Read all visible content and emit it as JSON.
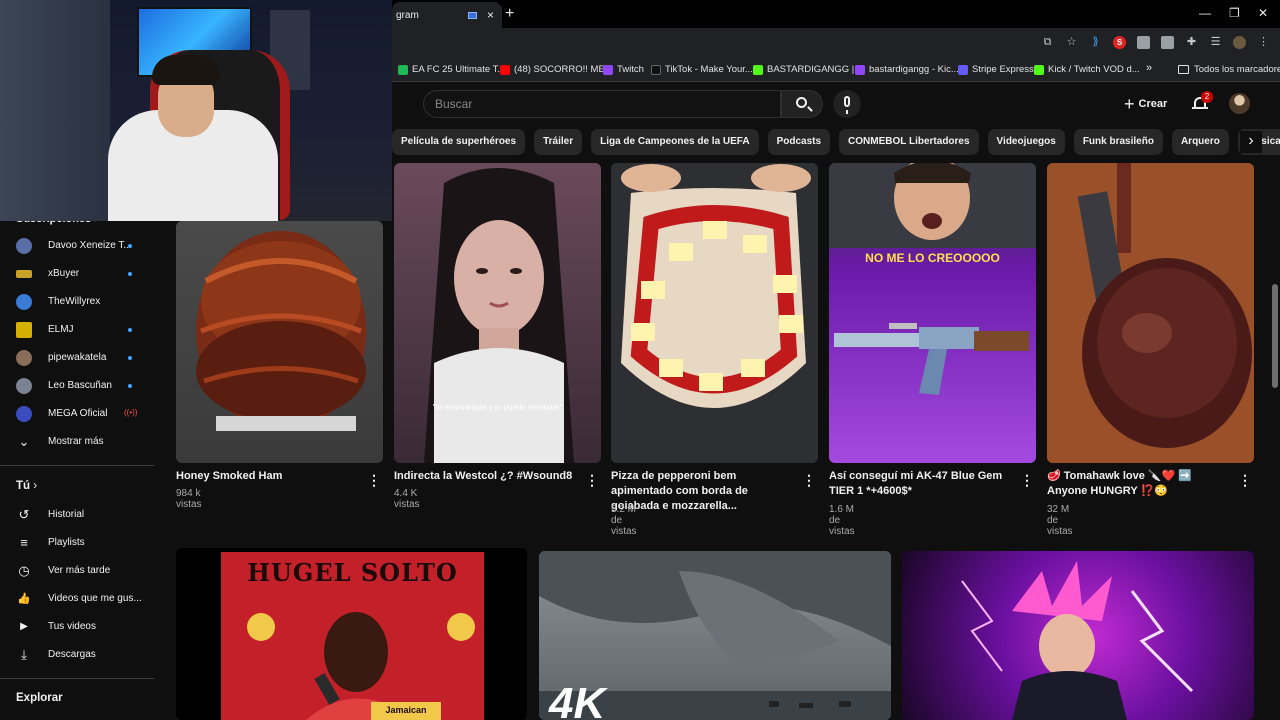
{
  "browser": {
    "tab_title": "gram",
    "new_tab": "+",
    "tab_close": "×",
    "window_minimize": "—",
    "window_restore": "❐",
    "window_close": "✕",
    "bookmarks": [
      {
        "label": "EA FC 25 Ultimate T...",
        "color": "#1db954"
      },
      {
        "label": "(48) SOCORRO!! ME...",
        "color": "#ff0000"
      },
      {
        "label": "Twitch",
        "color": "#9146ff"
      },
      {
        "label": "TikTok - Make Your...",
        "color": "#111111"
      },
      {
        "label": "BASTARDIGANGG |...",
        "color": "#53fc18"
      },
      {
        "label": "bastardigangg - Kic...",
        "color": "#9146ff"
      },
      {
        "label": "Stripe Express",
        "color": "#635bff"
      },
      {
        "label": "Kick / Twitch VOD d...",
        "color": "#53fc18"
      }
    ],
    "bookmarks_more": "»",
    "all_bookmarks": "Todos los marcadores"
  },
  "header": {
    "search_placeholder": "Buscar",
    "create_label": "Crear",
    "notification_count": "2"
  },
  "chips": [
    "Película de superhéroes",
    "Tráiler",
    "Liga de Campeones de la UEFA",
    "Podcasts",
    "CONMEBOL Libertadores",
    "Videojuegos",
    "Funk brasileño",
    "Arquero",
    "Música regional mexicana"
  ],
  "sidebar": {
    "subscriptions_title": "Suscripciones >",
    "subscriptions": [
      {
        "name": "Davoo Xeneize T...",
        "status": "new",
        "color": "#5a6fa8"
      },
      {
        "name": "xBuyer",
        "status": "new",
        "color": "#c9a227"
      },
      {
        "name": "TheWillyrex",
        "status": "none",
        "color": "#3a7bd5"
      },
      {
        "name": "ELMJ",
        "status": "new",
        "color": "#d4b000"
      },
      {
        "name": "pipewakatela",
        "status": "new",
        "color": "#8a6d5a"
      },
      {
        "name": "Leo Bascuñan",
        "status": "new",
        "color": "#7b8290"
      },
      {
        "name": "MEGA Oficial",
        "status": "live",
        "color": "#3b4cc0"
      }
    ],
    "live_glyph": "((•))",
    "show_more": "Mostrar más",
    "you_title": "Tú",
    "you_items": [
      {
        "label": "Historial",
        "icon": "history-icon",
        "glyph": "↺"
      },
      {
        "label": "Playlists",
        "icon": "playlist-icon",
        "glyph": "≡"
      },
      {
        "label": "Ver más tarde",
        "icon": "clock-icon",
        "glyph": "◷"
      },
      {
        "label": "Videos que me gus...",
        "icon": "like-icon",
        "glyph": "👍"
      },
      {
        "label": "Tus videos",
        "icon": "video-icon",
        "glyph": "▶"
      },
      {
        "label": "Descargas",
        "icon": "download-icon",
        "glyph": "⤓"
      }
    ],
    "explore_title": "Explorar"
  },
  "shorts": [
    {
      "title": "Honey Smoked Ham",
      "meta": "984 k vistas",
      "color1": "#7a2b16",
      "color2": "#3a3a3a"
    },
    {
      "title": "Indirecta la Westcol ¿? #Wsound8",
      "meta": "4.4 K vistas",
      "color1": "#3a2a35",
      "color2": "#d9b0a6",
      "caption": "\"te enamoraste y lo puedo entender\""
    },
    {
      "title": "Pizza de pepperoni bem apimentado com borda de goiabada e mozzarella...",
      "meta": "5.2 M de vistas",
      "color1": "#e7d8c4",
      "color2": "#c11a1a"
    },
    {
      "title": "Así conseguí mi AK-47 Blue Gem TIER 1 *+4600$*",
      "meta": "1.6 M de vistas",
      "color1": "#6a1aa8",
      "color2": "#a44ae0",
      "caption": "NO ME LO CREOOOOO"
    },
    {
      "title": "🥩 Tomahawk love 🔪❤️ ➡️ Anyone HUNGRY ⁉️😳",
      "meta": "32 M de vistas",
      "color1": "#5a2a20",
      "color2": "#a0502a"
    }
  ],
  "videos": [
    {
      "thumb_text": "HUGEL SOLTO",
      "sub_text": "Jamaican",
      "color1": "#8a1a1a",
      "color2": "#e33c3c"
    },
    {
      "thumb_text": "4K",
      "color1": "#4a5560",
      "color2": "#9aa3a8"
    },
    {
      "thumb_text": "",
      "color1": "#2a0a3a",
      "color2": "#c02ad0"
    }
  ],
  "menu_glyph": "⋮"
}
